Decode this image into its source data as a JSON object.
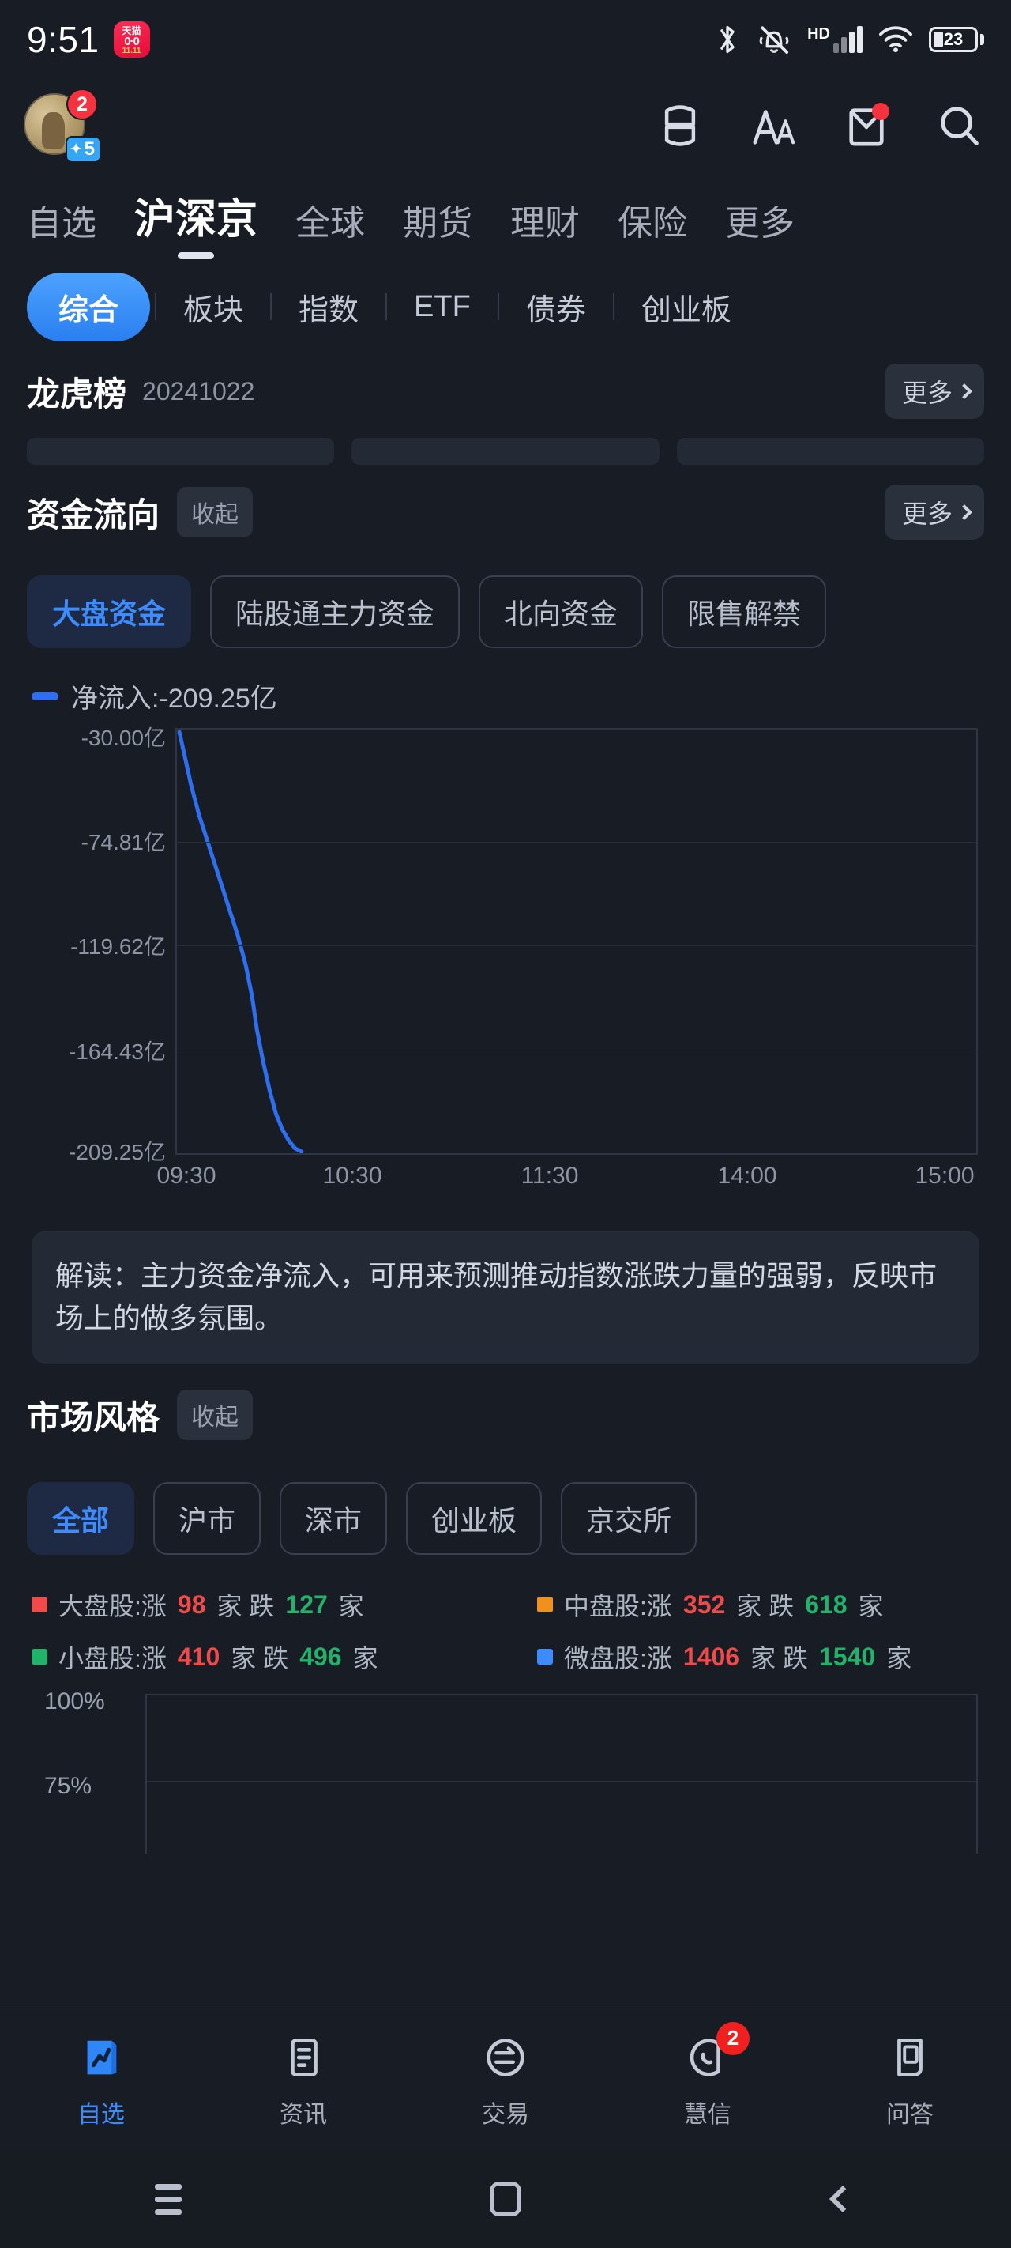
{
  "statusbar": {
    "time": "9:51",
    "tmall_top": "天猫",
    "tmall_mid": "0·0",
    "tmall_bot": "11.11",
    "hd_label": "HD",
    "battery_level": "23",
    "icons": [
      "bluetooth-icon",
      "mute-bell-icon",
      "hd-signal-icon",
      "wifi-icon",
      "battery-icon"
    ]
  },
  "appbar": {
    "avatar_badge": "2",
    "avatar_level": "5",
    "actions": [
      {
        "name": "layout-toggle-icon"
      },
      {
        "name": "font-size-icon"
      },
      {
        "name": "mail-icon"
      },
      {
        "name": "search-icon"
      }
    ]
  },
  "main_tabs": [
    {
      "label": "自选",
      "active": false
    },
    {
      "label": "沪深京",
      "active": true
    },
    {
      "label": "全球",
      "active": false
    },
    {
      "label": "期货",
      "active": false
    },
    {
      "label": "理财",
      "active": false
    },
    {
      "label": "保险",
      "active": false
    },
    {
      "label": "更多",
      "active": false
    }
  ],
  "sub_tabs": [
    {
      "label": "综合",
      "active": true
    },
    {
      "label": "板块",
      "active": false
    },
    {
      "label": "指数",
      "active": false
    },
    {
      "label": "ETF",
      "active": false
    },
    {
      "label": "债券",
      "active": false
    },
    {
      "label": "创业板",
      "active": false
    }
  ],
  "dragon_tiger": {
    "title": "龙虎榜",
    "date": "20241022",
    "more_label": "更多"
  },
  "fund_flow": {
    "title": "资金流向",
    "collapse_label": "收起",
    "more_label": "更多",
    "chips": [
      {
        "label": "大盘资金",
        "active": true
      },
      {
        "label": "陆股通主力资金",
        "active": false
      },
      {
        "label": "北向资金",
        "active": false
      },
      {
        "label": "限售解禁",
        "active": false
      }
    ],
    "legend_text": "净流入:-209.25亿",
    "legend_color": "#2e6ff2",
    "note": "解读：主力资金净流入，可用来预测推动指数涨跌力量的强弱，反映市场上的做多氛围。"
  },
  "market_style": {
    "title": "市场风格",
    "collapse_label": "收起",
    "chips": [
      {
        "label": "全部",
        "active": true
      },
      {
        "label": "沪市",
        "active": false
      },
      {
        "label": "深市",
        "active": false
      },
      {
        "label": "创业板",
        "active": false
      },
      {
        "label": "京交所",
        "active": false
      }
    ],
    "legend": [
      {
        "name": "大盘股",
        "color": "#f04a4a",
        "prefix": "大盘股:涨",
        "up": "98",
        "mid": "家 跌 ",
        "down": "127",
        "suffix": " 家"
      },
      {
        "name": "中盘股",
        "color": "#f0901e",
        "prefix": "中盘股:涨",
        "up": "352",
        "mid": "家 跌 ",
        "down": "618",
        "suffix": " 家"
      },
      {
        "name": "小盘股",
        "color": "#22b26a",
        "prefix": "小盘股:涨",
        "up": "410",
        "mid": "家 跌 ",
        "down": "496",
        "suffix": " 家"
      },
      {
        "name": "微盘股",
        "color": "#3d8bfd",
        "prefix": "微盘股:涨",
        "up": "1406",
        "mid": "家 跌 ",
        "down": "1540",
        "suffix": " 家"
      }
    ],
    "y_labels": [
      "100%",
      "75%"
    ]
  },
  "bottom_nav": [
    {
      "label": "自选",
      "icon": "chart-card-icon",
      "active": true,
      "badge": null
    },
    {
      "label": "资讯",
      "icon": "news-document-icon",
      "active": false,
      "badge": null
    },
    {
      "label": "交易",
      "icon": "trade-exchange-icon",
      "active": false,
      "badge": null
    },
    {
      "label": "慧信",
      "icon": "message-phone-icon",
      "active": false,
      "badge": "2"
    },
    {
      "label": "问答",
      "icon": "qa-scroll-icon",
      "active": false,
      "badge": null
    }
  ],
  "system_nav": [
    {
      "name": "recent-apps-button"
    },
    {
      "name": "home-button"
    },
    {
      "name": "back-button"
    }
  ],
  "chart_data": [
    {
      "type": "line",
      "title": "净流入:-209.25亿",
      "xlabel": "",
      "ylabel": "",
      "unit": "亿",
      "ytick_labels": [
        "-30.00亿",
        "-74.81亿",
        "-119.62亿",
        "-164.43亿",
        "-209.25亿"
      ],
      "ytick_values": [
        -30.0,
        -74.81,
        -119.62,
        -164.43,
        -209.25
      ],
      "ylim": [
        -209.25,
        -30.0
      ],
      "xtick_labels": [
        "09:30",
        "10:30",
        "11:30",
        "14:00",
        "15:00"
      ],
      "grid": true,
      "legend_position": "top-left",
      "series": [
        {
          "name": "净流入",
          "color": "#2e6ff2",
          "x": [
            "09:30",
            "09:33",
            "09:36",
            "09:40",
            "09:45",
            "09:50",
            "09:55",
            "10:00",
            "10:05",
            "10:10",
            "10:14"
          ],
          "values": [
            -30.0,
            -52.0,
            -74.8,
            -96.0,
            -119.6,
            -142.0,
            -164.4,
            -182.0,
            -196.0,
            -205.0,
            -209.25
          ]
        }
      ]
    },
    {
      "type": "line",
      "title": "市场风格",
      "ytick_labels": [
        "100%",
        "75%"
      ],
      "ytick_values": [
        100,
        75
      ],
      "ylim": [
        0,
        100
      ],
      "grid": true,
      "series": [
        {
          "name": "大盘股",
          "color": "#f04a4a",
          "values": []
        },
        {
          "name": "中盘股",
          "color": "#f0901e",
          "values": []
        },
        {
          "name": "小盘股",
          "color": "#22b26a",
          "values": []
        },
        {
          "name": "微盘股",
          "color": "#3d8bfd",
          "values": []
        }
      ]
    }
  ]
}
